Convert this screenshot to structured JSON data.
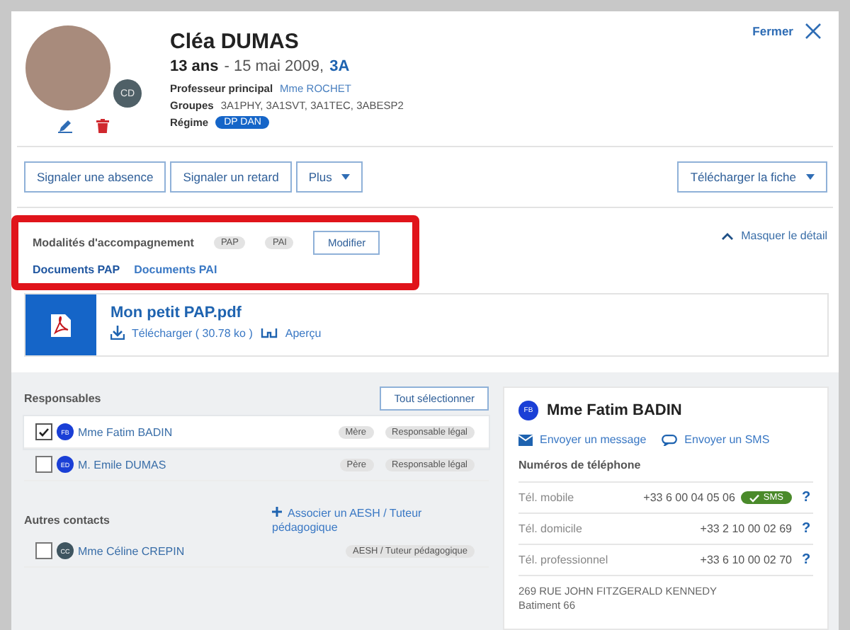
{
  "header": {
    "close": "Fermer",
    "student": {
      "initials": "CD",
      "name": "Cléa DUMAS",
      "age": "13 ans",
      "birth": "- 15 mai 2009,",
      "class": "3A",
      "details": [
        {
          "label": "Professeur principal",
          "value": "Mme ROCHET",
          "kind": "link"
        },
        {
          "label": "Groupes",
          "value": "3A1PHY, 3A1SVT, 3A1TEC, 3ABESP2",
          "kind": "text"
        },
        {
          "label": "Régime",
          "value": "DP DAN",
          "kind": "badge"
        }
      ]
    }
  },
  "actions": [
    {
      "label": "Signaler une absence",
      "kind": "button"
    },
    {
      "label": "Signaler un retard",
      "kind": "button"
    },
    {
      "label": "Plus",
      "kind": "dropdown"
    }
  ],
  "download": {
    "label": "Télécharger la fiche"
  },
  "support": {
    "label": "Modalités d'accompagnement",
    "chips": [
      "PAP",
      "PAI"
    ],
    "edit": "Modifier",
    "toggle": "Masquer le détail",
    "expanded": true,
    "highlighted": true,
    "tabs": [
      {
        "label": "Documents PAP",
        "selected": true
      },
      {
        "label": "Documents PAI",
        "selected": false
      }
    ]
  },
  "document": {
    "title": "Mon petit PAP.pdf",
    "download": "Télécharger ( 30.78 ko )",
    "preview": "Aperçu"
  },
  "responsables": {
    "title": "Responsables",
    "select_all": "Tout sélectionner",
    "rows": [
      {
        "initials": "FB",
        "name": "Mme Fatim BADIN",
        "checked": true,
        "selected": true,
        "color": "#1a3fd6",
        "tags": [
          "Mère",
          "Responsable légal"
        ]
      },
      {
        "initials": "ED",
        "name": "M. Emile DUMAS",
        "checked": false,
        "selected": false,
        "color": "#1a3fd6",
        "tags": [
          "Père",
          "Responsable légal"
        ]
      }
    ]
  },
  "other_contacts": {
    "title": "Autres contacts",
    "add": "Associer un AESH / Tuteur pédagogique",
    "rows": [
      {
        "initials": "CC",
        "name": "Mme Céline CREPIN",
        "checked": false,
        "selected": false,
        "color": "#3f5560",
        "tags": [
          "AESH / Tuteur pédagogique"
        ]
      }
    ]
  },
  "contact_card": {
    "initials": "FB",
    "name": "Mme Fatim BADIN",
    "message": "Envoyer un message",
    "sms_link": "Envoyer un SMS",
    "phones_title": "Numéros de téléphone",
    "phones": [
      {
        "label": "Tél. mobile",
        "number": "+33 6 00 04 05 06",
        "sms": "SMS"
      },
      {
        "label": "Tél. domicile",
        "number": "+33 2 10 00 02 69"
      },
      {
        "label": "Tél. professionnel",
        "number": "+33 6 10 00 02 70"
      }
    ],
    "help": "?",
    "address": [
      "269 RUE JOHN FITZGERALD KENNEDY",
      "Batiment 66"
    ]
  }
}
